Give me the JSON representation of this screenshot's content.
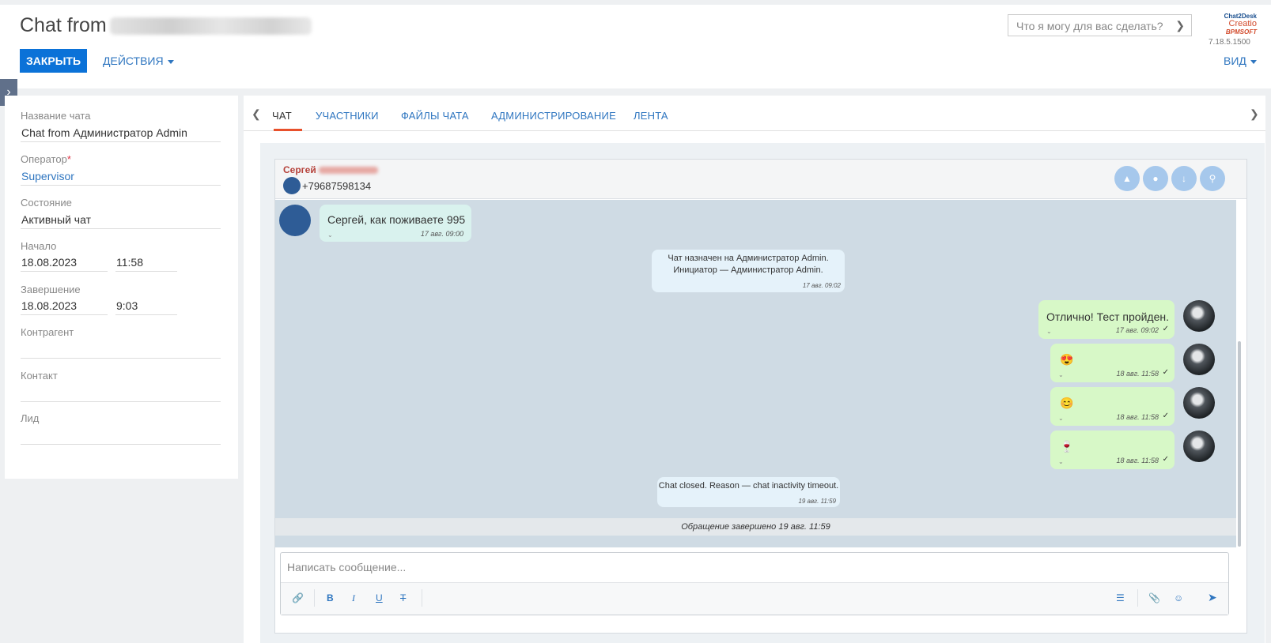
{
  "header": {
    "title_prefix": "Chat from",
    "close_label": "ЗАКРЫТЬ",
    "actions_label": "ДЕЙСТВИЯ",
    "search_placeholder": "Что я могу для вас сделать?",
    "logo_line1": "Chat2Desk",
    "logo_line2": "Creatio",
    "logo_line3": "BPMSOFT",
    "version": "7.18.5.1500",
    "view_label": "ВИД"
  },
  "sidebar_toggle_icon": "chevron-right-icon",
  "form": {
    "chat_name_label": "Название чата",
    "chat_name_value": "Chat from Администратор Admin",
    "operator_label": "Оператор",
    "operator_required": "*",
    "operator_value": "Supervisor",
    "state_label": "Состояние",
    "state_value": "Активный чат",
    "start_label": "Начало",
    "start_date": "18.08.2023",
    "start_time": "11:58",
    "end_label": "Завершение",
    "end_date": "18.08.2023",
    "end_time": "9:03",
    "account_label": "Контрагент",
    "contact_label": "Контакт",
    "lead_label": "Лид"
  },
  "tabs": [
    {
      "label": "ЧАТ",
      "active": true
    },
    {
      "label": "УЧАСТНИКИ"
    },
    {
      "label": "ФАЙЛЫ ЧАТА"
    },
    {
      "label": "АДМИНИСТРИРОВАНИЕ"
    },
    {
      "label": "ЛЕНТА"
    }
  ],
  "chat": {
    "contact_first_name": "Сергей",
    "phone": "+79687598134",
    "messages": [
      {
        "type": "in",
        "text": "Сергей, как поживаете 995",
        "time": "17 авг. 09:00"
      },
      {
        "type": "system",
        "line1": "Чат назначен на Администратор Admin.",
        "line2": "Инициатор — Администратор Admin.",
        "time": "17 авг. 09:02"
      },
      {
        "type": "out",
        "text": "Отлично! Тест пройден.",
        "time": "17 авг. 09:02"
      },
      {
        "type": "out",
        "text": "😍",
        "time": "18 авг. 11:58"
      },
      {
        "type": "out",
        "text": "😊",
        "time": "18 авг. 11:58"
      },
      {
        "type": "out",
        "text": "🍷",
        "time": "18 авг. 11:58"
      },
      {
        "type": "system",
        "line1": "Chat closed. Reason — chat inactivity timeout.",
        "time": "19 авг. 11:59"
      }
    ],
    "closed_notice": "Обращение завершено 19 авг. 11:59",
    "compose_placeholder": "Написать сообщение..."
  },
  "colors": {
    "primary_button": "#0b72d8",
    "link": "#2f76c0",
    "active_tab_underline": "#e8502b",
    "outgoing_bubble": "#d7f8c7",
    "incoming_bubble": "#d9f2ee",
    "chat_background": "#cfdbe4"
  }
}
